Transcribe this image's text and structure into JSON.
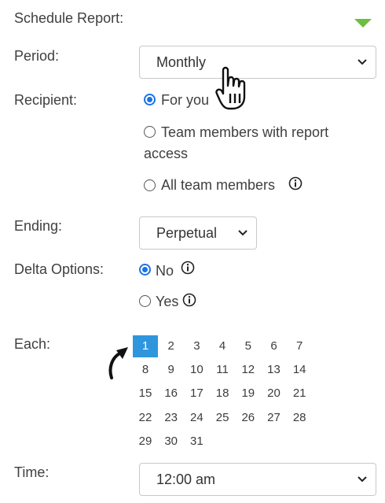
{
  "header": {
    "title": "Schedule Report:",
    "accent_color": "#6cbf3f"
  },
  "period": {
    "label": "Period:",
    "selected": "Monthly"
  },
  "recipient": {
    "label": "Recipient:",
    "options": [
      {
        "label": "For you",
        "checked": true
      },
      {
        "label_line1": "Team members with report",
        "label_line2": "access",
        "checked": false
      },
      {
        "label": "All team members",
        "checked": false
      }
    ]
  },
  "ending": {
    "label": "Ending:",
    "selected": "Perpetual"
  },
  "delta": {
    "label": "Delta Options:",
    "options": [
      {
        "label": "No",
        "checked": true
      },
      {
        "label": "Yes",
        "checked": false
      }
    ]
  },
  "each": {
    "label": "Each:",
    "days": [
      "1",
      "2",
      "3",
      "4",
      "5",
      "6",
      "7",
      "8",
      "9",
      "10",
      "11",
      "12",
      "13",
      "14",
      "15",
      "16",
      "17",
      "18",
      "19",
      "20",
      "21",
      "22",
      "23",
      "24",
      "25",
      "26",
      "27",
      "28",
      "29",
      "30",
      "31"
    ],
    "selected_day": "1",
    "selected_color": "#2f96de"
  },
  "time": {
    "label": "Time:",
    "selected": "12:00 am"
  },
  "icons": {
    "collapse": "triangle-down-icon",
    "info": "info-circle-icon",
    "cursor": "hand-pointer-icon",
    "arrow": "curved-arrow-icon"
  }
}
